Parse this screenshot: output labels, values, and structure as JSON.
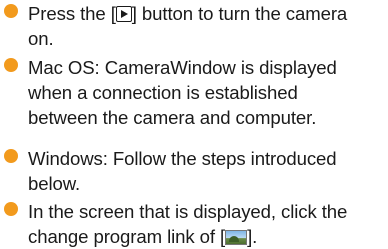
{
  "bullet_color": "#f29a1d",
  "icons": {
    "play": "play-button-icon",
    "photo": "photo-import-icon"
  },
  "items": [
    {
      "line1_before": "Press the [",
      "line1_after": "] button to turn the camera",
      "line2": "on."
    },
    {
      "line1": "Mac OS: CameraWindow is displayed",
      "line2": "when a connection is established",
      "line3": "between the camera and computer."
    },
    {
      "line1": "Windows: Follow the steps introduced",
      "line2": "below."
    },
    {
      "line1": "In the screen that is displayed, click the",
      "line2_before": "change program link of [",
      "line2_after": "]."
    }
  ]
}
